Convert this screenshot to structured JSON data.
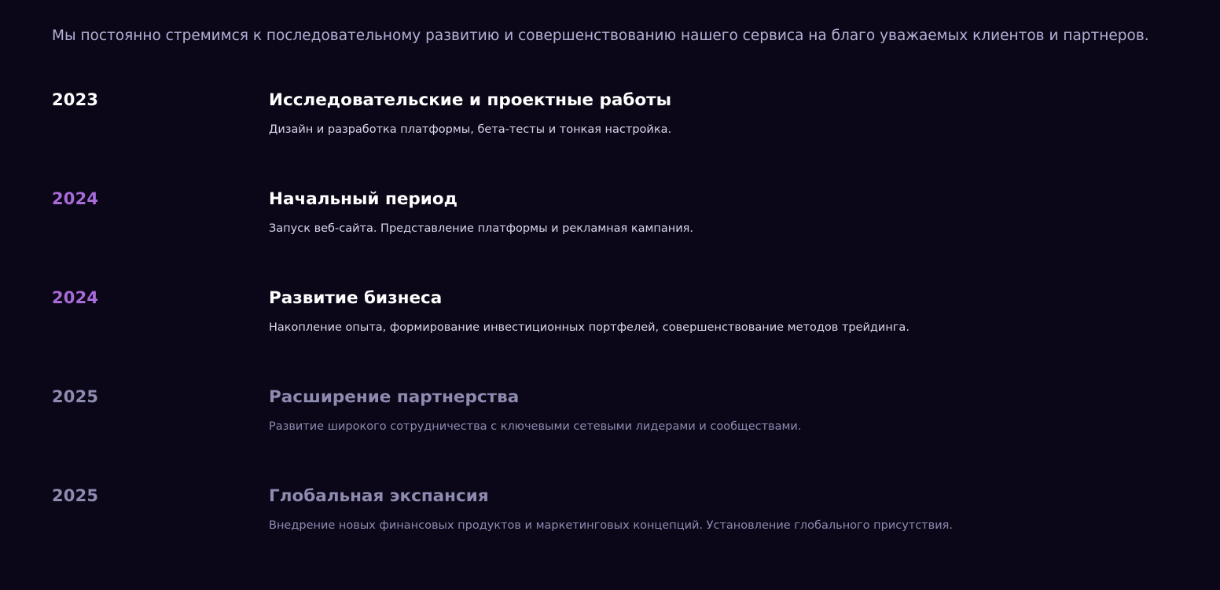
{
  "intro": "Мы постоянно стремимся к последовательному развитию и совершенствованию нашего сервиса на благо уважаемых клиентов и партнеров.",
  "timeline": [
    {
      "year": "2023",
      "title": "Исследовательские и проектные работы",
      "description": "Дизайн и разработка платформы, бета-тесты и тонкая настройка.",
      "state": "done"
    },
    {
      "year": "2024",
      "title": "Начальный период",
      "description": "Запуск веб-сайта. Представление платформы и рекламная кампания.",
      "state": "active"
    },
    {
      "year": "2024",
      "title": "Развитие бизнеса",
      "description": "Накопление опыта, формирование инвестиционных портфелей, совершенствование методов трейдинга.",
      "state": "active"
    },
    {
      "year": "2025",
      "title": "Расширение партнерства",
      "description": "Развитие широкого сотрудничества с ключевыми сетевыми лидерами и сообществами.",
      "state": "future"
    },
    {
      "year": "2025",
      "title": "Глобальная экспансия",
      "description": "Внедрение новых финансовых продуктов и маркетинговых концепций. Установление глобального присутствия.",
      "state": "future"
    }
  ],
  "colors": {
    "background": "#0b0718",
    "completed_year": "#ffffff",
    "current_year": "#a86bd8",
    "upcoming": "#8e8ab0"
  }
}
